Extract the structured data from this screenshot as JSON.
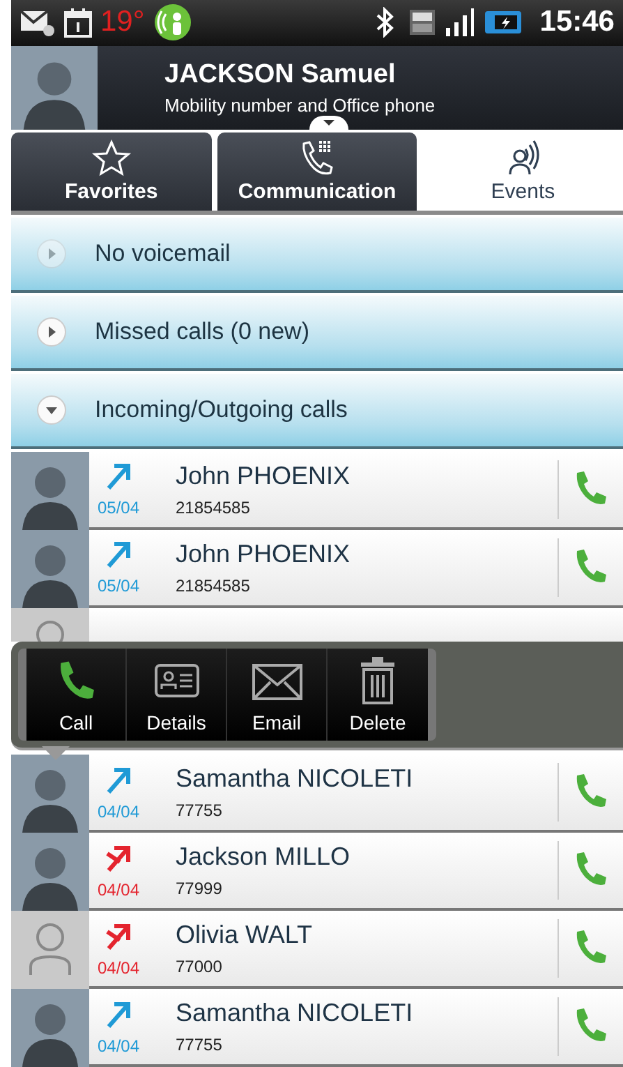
{
  "status_bar": {
    "temperature": "19°",
    "time": "15:46"
  },
  "contact": {
    "name": "JACKSON Samuel",
    "subtitle": "Mobility number and Office phone"
  },
  "tabs": [
    {
      "label": "Favorites",
      "selected": false
    },
    {
      "label": "Communication",
      "selected": false
    },
    {
      "label": "Events",
      "selected": true
    }
  ],
  "sections": [
    {
      "label": "No voicemail",
      "expanded": false,
      "disabled": true
    },
    {
      "label": "Missed calls (0 new)",
      "expanded": false,
      "disabled": false
    },
    {
      "label": "Incoming/Outgoing calls",
      "expanded": true,
      "disabled": false
    }
  ],
  "calls_before": [
    {
      "name": "John PHOENIX",
      "number": "21854585",
      "date": "05/04",
      "kind": "outgoing",
      "photo": true
    },
    {
      "name": "John PHOENIX",
      "number": "21854585",
      "date": "05/04",
      "kind": "outgoing",
      "photo": true
    }
  ],
  "popup_actions": [
    {
      "label": "Call"
    },
    {
      "label": "Details"
    },
    {
      "label": "Email"
    },
    {
      "label": "Delete"
    }
  ],
  "calls_after": [
    {
      "name": "Samantha NICOLETI",
      "number": "77755",
      "date": "04/04",
      "kind": "outgoing",
      "photo": true
    },
    {
      "name": "Jackson MILLO",
      "number": "77999",
      "date": "04/04",
      "kind": "missed",
      "photo": true
    },
    {
      "name": "Olivia WALT",
      "number": "77000",
      "date": "04/04",
      "kind": "missed",
      "photo": false
    },
    {
      "name": "Samantha NICOLETI",
      "number": "77755",
      "date": "04/04",
      "kind": "outgoing",
      "photo": true
    }
  ]
}
